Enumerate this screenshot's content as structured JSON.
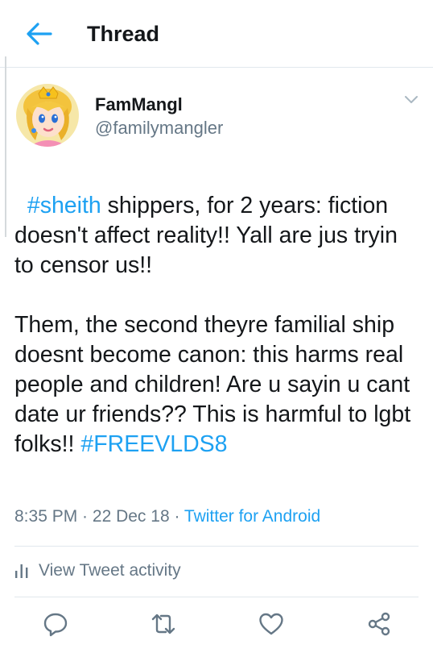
{
  "header": {
    "title": "Thread",
    "back_icon": "back-arrow-icon",
    "accent": "#1da1f2"
  },
  "tweet": {
    "display_name": "FamMangl",
    "handle": "@familymangler",
    "segments": [
      {
        "type": "hashtag",
        "text": "#sheith"
      },
      {
        "type": "text",
        "text": " shippers, for 2 years: fiction doesn't affect reality!! Yall are jus tryin to censor us!!\n\nThem, the second theyre familial ship doesnt become canon: this harms real people and children! Are u sayin u cant date ur friends?? This is harmful to lgbt folks!! "
      },
      {
        "type": "hashtag",
        "text": "#FREEVLDS8"
      }
    ],
    "time": "8:35 PM",
    "separator": " · ",
    "date": "22 Dec 18",
    "source": "Twitter for Android",
    "link_color": "#1da1f2",
    "muted_color": "#657786"
  },
  "activity": {
    "label": "View Tweet activity",
    "icon": "bar-chart-icon"
  },
  "actions": [
    {
      "name": "reply-icon"
    },
    {
      "name": "retweet-icon"
    },
    {
      "name": "like-icon"
    },
    {
      "name": "share-icon"
    }
  ]
}
